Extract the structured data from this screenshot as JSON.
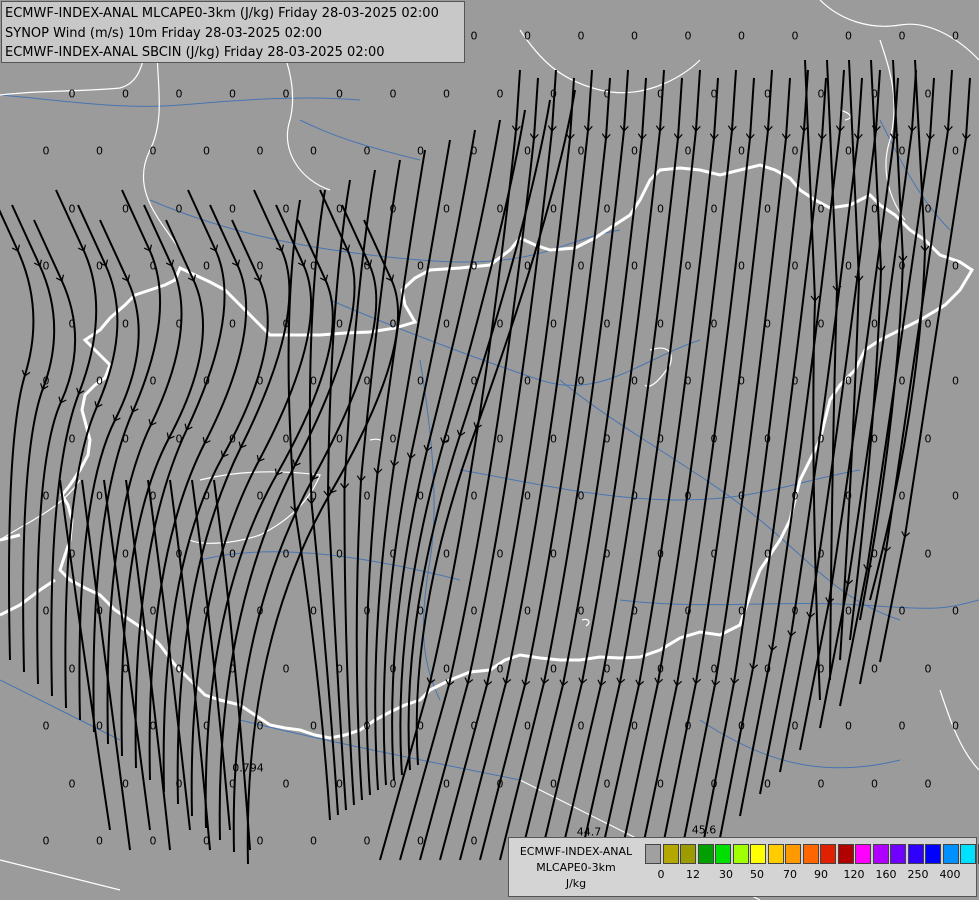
{
  "header": {
    "line1": "ECMWF-INDEX-ANAL MLCAPE0-3km (J/kg) Friday 28-03-2025 02:00",
    "line2": "SYNOP Wind (m/s) 10m Friday 28-03-2025 02:00",
    "line3": "ECMWF-INDEX-ANAL SBCIN (J/kg) Friday 28-03-2025 02:00"
  },
  "legend": {
    "title_line1": "ECMWF-INDEX-ANAL",
    "title_line2": "MLCAPE0-3km",
    "title_line3": "J/kg",
    "colors": [
      "#a0a0a0",
      "#b4a800",
      "#9c9c00",
      "#00a000",
      "#00e000",
      "#a0ff00",
      "#ffff00",
      "#ffcc00",
      "#ff9900",
      "#ff6600",
      "#e02000",
      "#b00000",
      "#ff00ff",
      "#b000ff",
      "#7000ff",
      "#3000ff",
      "#0000ff",
      "#0090ff",
      "#00e0ff",
      "#80ffff",
      "#ffffff"
    ],
    "tick_labels": [
      "0",
      "12",
      "30",
      "50",
      "70",
      "90",
      "120",
      "160",
      "250",
      "400"
    ]
  },
  "map": {
    "field_value": "0",
    "special_labels": [
      "44.7",
      "45.6",
      "0.794"
    ]
  }
}
